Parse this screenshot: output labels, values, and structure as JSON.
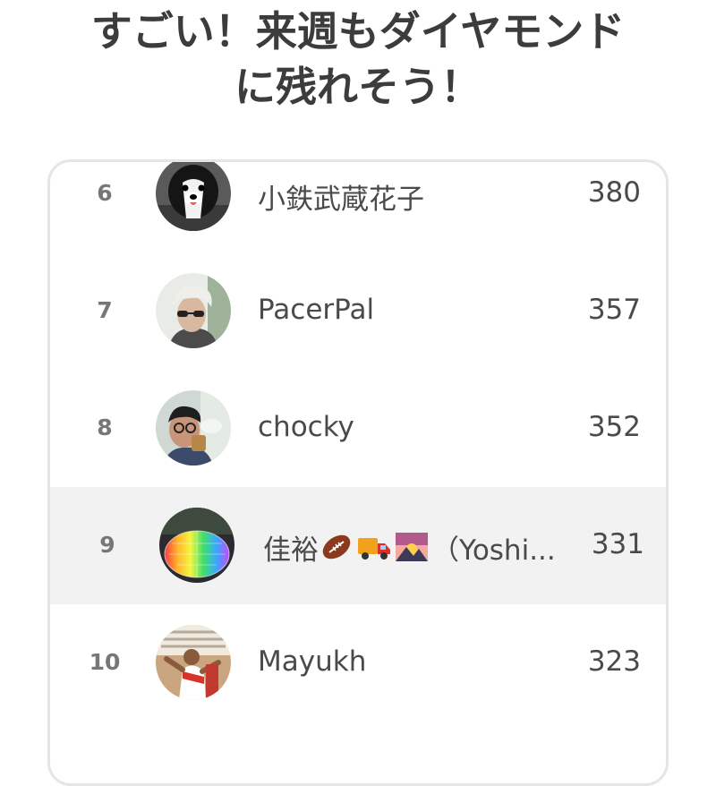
{
  "headline": {
    "line1": "すごい！来週もダイヤモンド",
    "line2": "に残れそう！"
  },
  "leaderboard": {
    "rows": [
      {
        "rank": "6",
        "name": "小鉄武蔵花子",
        "score": "380",
        "avatar": "dog-avatar"
      },
      {
        "rank": "7",
        "name": "PacerPal",
        "score": "357",
        "avatar": "blonde-person-avatar"
      },
      {
        "rank": "8",
        "name": "chocky",
        "score": "352",
        "avatar": "person-drinking-avatar"
      },
      {
        "rank": "9",
        "name_prefix": "佳裕",
        "name_suffix": "（Yoshi...",
        "emojis": [
          "american-football-icon",
          "delivery-truck-icon",
          "sunrise-over-mountains-icon"
        ],
        "score": "331",
        "avatar": "rainbow-dome-avatar",
        "highlighted": true
      },
      {
        "rank": "10",
        "name": "Mayukh",
        "score": "323",
        "avatar": "runner-avatar"
      }
    ]
  },
  "colors": {
    "text": "#3c3c3c",
    "rank": "#777777",
    "card_border": "#e5e5e5",
    "highlight_row": "#f2f2f2"
  }
}
